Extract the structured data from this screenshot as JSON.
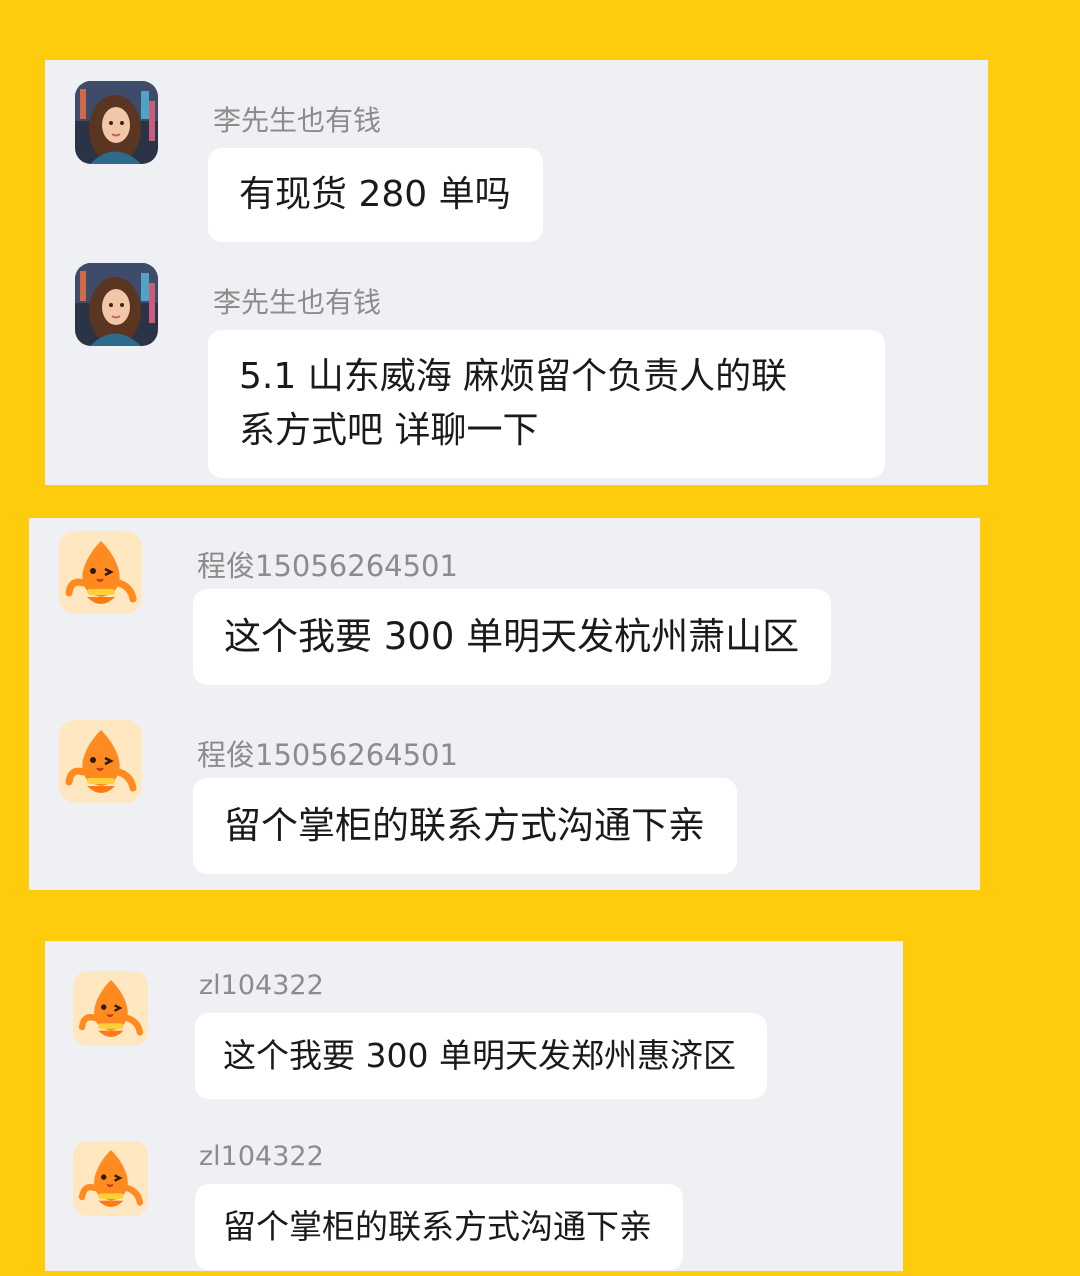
{
  "panels": [
    {
      "messages": [
        {
          "avatar": "woman-portrait-avatar",
          "username": "李先生也有钱",
          "text": "有现货 280 单吗"
        },
        {
          "avatar": "woman-portrait-avatar",
          "username": "李先生也有钱",
          "text_line1": "5.1 山东威海 麻烦留个负责人的联",
          "text_line2": "系方式吧  详聊一下"
        }
      ]
    },
    {
      "messages": [
        {
          "avatar": "orange-mascot-avatar",
          "username": "程俊15056264501",
          "text": "这个我要 300 单明天发杭州萧山区"
        },
        {
          "avatar": "orange-mascot-avatar",
          "username": "程俊15056264501",
          "text": "留个掌柜的联系方式沟通下亲"
        }
      ]
    },
    {
      "messages": [
        {
          "avatar": "orange-mascot-avatar",
          "username": "zl104322",
          "text": "这个我要 300 单明天发郑州惠济区"
        },
        {
          "avatar": "orange-mascot-avatar",
          "username": "zl104322",
          "text": "留个掌柜的联系方式沟通下亲"
        }
      ]
    }
  ],
  "colors": {
    "background": "#FFCC0D",
    "panel": "#EFF0F3",
    "bubble": "#FFFFFF",
    "username": "#8C8C8C",
    "text": "#1A1A1A",
    "mascot": "#FF8A1F"
  }
}
